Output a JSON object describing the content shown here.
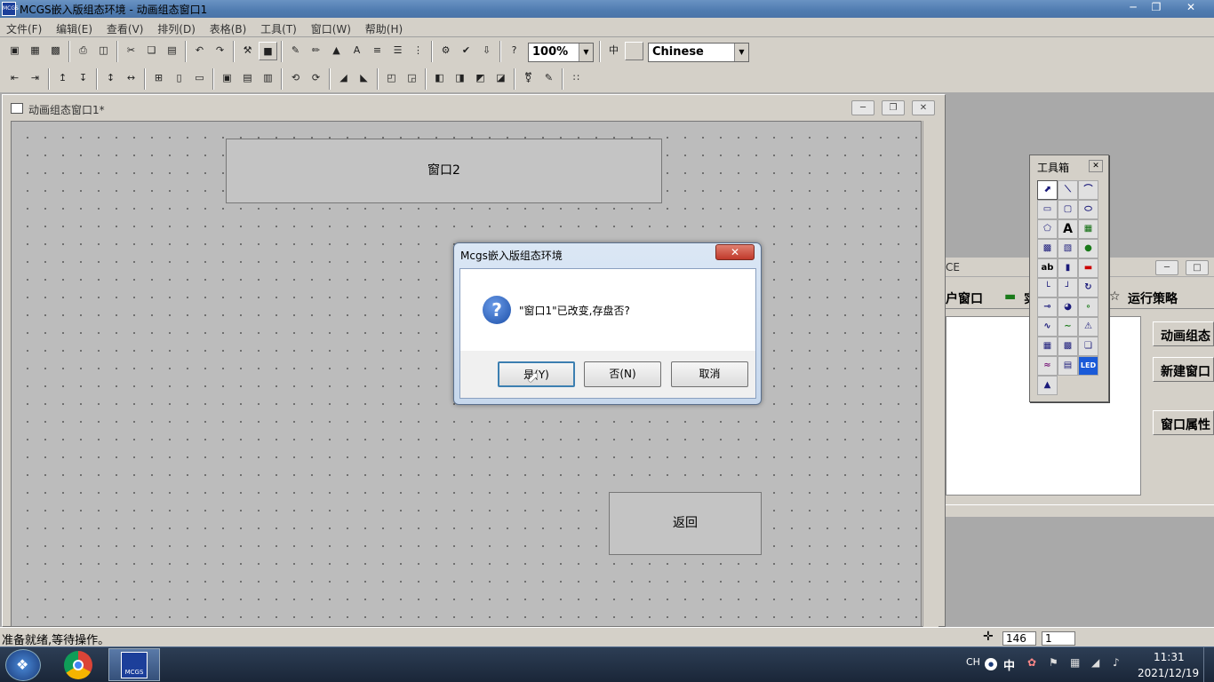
{
  "window": {
    "title": "MCGS嵌入版组态环境 - 动画组态窗口1",
    "icon_label": "MCGS",
    "minimize_icon": "minimize-icon",
    "restore_icon": "restore-icon",
    "close_icon": "close-icon"
  },
  "menu": [
    "文件(F)",
    "编辑(E)",
    "查看(V)",
    "排列(D)",
    "表格(B)",
    "工具(T)",
    "窗口(W)",
    "帮助(H)"
  ],
  "toolbar": {
    "zoom": "100%",
    "language": "Chinese"
  },
  "child_window": {
    "title": "动画组态窗口1*"
  },
  "canvas": {
    "window2_button": "窗口2",
    "return_button": "返回"
  },
  "right_panel": {
    "title_fragment": "CE",
    "tab1": "户窗口",
    "tab2": "实",
    "tab3": "运行策略",
    "btn1": "动画组态",
    "btn2": "新建窗口",
    "btn3": "窗口属性"
  },
  "toolbox": {
    "title": "工具箱",
    "close_icon": "close-icon"
  },
  "dialog": {
    "title": "Mcgs嵌入版组态环境",
    "message": "\"窗口1\"已改变,存盘否?",
    "yes": "是(Y)",
    "no": "否(N)",
    "cancel": "取消"
  },
  "status": {
    "text": "准备就绪,等待操作。",
    "x": "146",
    "y": "1"
  },
  "taskbar": {
    "app_label": "MCGS",
    "ime": "CH",
    "ime_mode": "中",
    "time": "11:31",
    "date": "2021/12/19"
  }
}
